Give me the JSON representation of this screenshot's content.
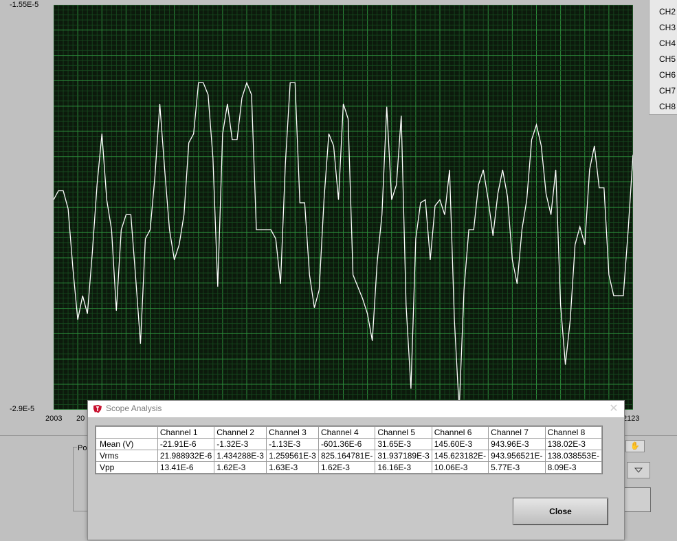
{
  "graph": {
    "y_top_label": "-1.55E-5",
    "y_bottom_label": "-2.9E-5",
    "x_left_label": "2003",
    "x_left2_label": "20",
    "x_right_label": "2123",
    "y_axis_title": "",
    "colors": {
      "background": "#0c1a0c",
      "grid": "#1f6a2b",
      "trace": "#ffffff"
    },
    "trace_y": [
      -2.2e-05,
      -2.17e-05,
      -2.17e-05,
      -2.23e-05,
      -2.43e-05,
      -2.6e-05,
      -2.52e-05,
      -2.58e-05,
      -2.38e-05,
      -2.15e-05,
      -1.98e-05,
      -2.2e-05,
      -2.3e-05,
      -2.57e-05,
      -2.3e-05,
      -2.25e-05,
      -2.25e-05,
      -2.46e-05,
      -2.68e-05,
      -2.33e-05,
      -2.3e-05,
      -2.12e-05,
      -1.88e-05,
      -2.1e-05,
      -2.3e-05,
      -2.4e-05,
      -2.35e-05,
      -2.25e-05,
      -2.01e-05,
      -1.98e-05,
      -1.81e-05,
      -1.81e-05,
      -1.85e-05,
      -2.06e-05,
      -2.49e-05,
      -1.98e-05,
      -1.88e-05,
      -2e-05,
      -2e-05,
      -1.86e-05,
      -1.81e-05,
      -1.85e-05,
      -2.3e-05,
      -2.3e-05,
      -2.3e-05,
      -2.3e-05,
      -2.33e-05,
      -2.48e-05,
      -2.08e-05,
      -1.81e-05,
      -1.81e-05,
      -2.21e-05,
      -2.21e-05,
      -2.45e-05,
      -2.56e-05,
      -2.5e-05,
      -2.2e-05,
      -1.98e-05,
      -2.02e-05,
      -2.2e-05,
      -1.88e-05,
      -1.93e-05,
      -2.45e-05,
      -2.49e-05,
      -2.53e-05,
      -2.58e-05,
      -2.67e-05,
      -2.41e-05,
      -2.25e-05,
      -1.89e-05,
      -2.2e-05,
      -2.15e-05,
      -1.92e-05,
      -2.55e-05,
      -2.83e-05,
      -2.33e-05,
      -2.21e-05,
      -2.2e-05,
      -2.4e-05,
      -2.22e-05,
      -2.2e-05,
      -2.25e-05,
      -2.1e-05,
      -2.6e-05,
      -2.9e-05,
      -2.5e-05,
      -2.3e-05,
      -2.3e-05,
      -2.15e-05,
      -2.1e-05,
      -2.2e-05,
      -2.32e-05,
      -2.18e-05,
      -2.1e-05,
      -2.19e-05,
      -2.4e-05,
      -2.48e-05,
      -2.3e-05,
      -2.2e-05,
      -2e-05,
      -1.95e-05,
      -2.02e-05,
      -2.18e-05,
      -2.25e-05,
      -2.1e-05,
      -2.55e-05,
      -2.75e-05,
      -2.6e-05,
      -2.35e-05,
      -2.29e-05,
      -2.35e-05,
      -2.1e-05,
      -2.02e-05,
      -2.16e-05,
      -2.16e-05,
      -2.45e-05,
      -2.52e-05,
      -2.52e-05,
      -2.52e-05,
      -2.3e-05,
      -2.05e-05
    ]
  },
  "legend": {
    "items": [
      "CH2",
      "CH3",
      "CH4",
      "CH5",
      "CH6",
      "CH7",
      "CH8"
    ]
  },
  "background_panel": {
    "pos_label": "Pos"
  },
  "dialog": {
    "title": "Scope Analysis",
    "close_label": "Close",
    "table": {
      "columns": [
        "",
        "Channel 1",
        "Channel 2",
        "Channel 3",
        "Channel 4",
        "Channel 5",
        "Channel 6",
        "Channel 7",
        "Channel 8"
      ],
      "rows": [
        [
          "Mean (V)",
          "-21.91E-6",
          "-1.32E-3",
          "-1.13E-3",
          "-601.36E-6",
          "31.65E-3",
          "145.60E-3",
          "943.96E-3",
          "138.02E-3"
        ],
        [
          "Vrms",
          "21.988932E-6",
          "1.434288E-3",
          "1.259561E-3",
          "825.164781E-",
          "31.937189E-3",
          "145.623182E-",
          "943.956521E-",
          "138.038553E-"
        ],
        [
          "Vpp",
          "13.41E-6",
          "1.62E-3",
          "1.63E-3",
          "1.62E-3",
          "16.16E-3",
          "10.06E-3",
          "5.77E-3",
          "8.09E-3"
        ]
      ]
    }
  }
}
